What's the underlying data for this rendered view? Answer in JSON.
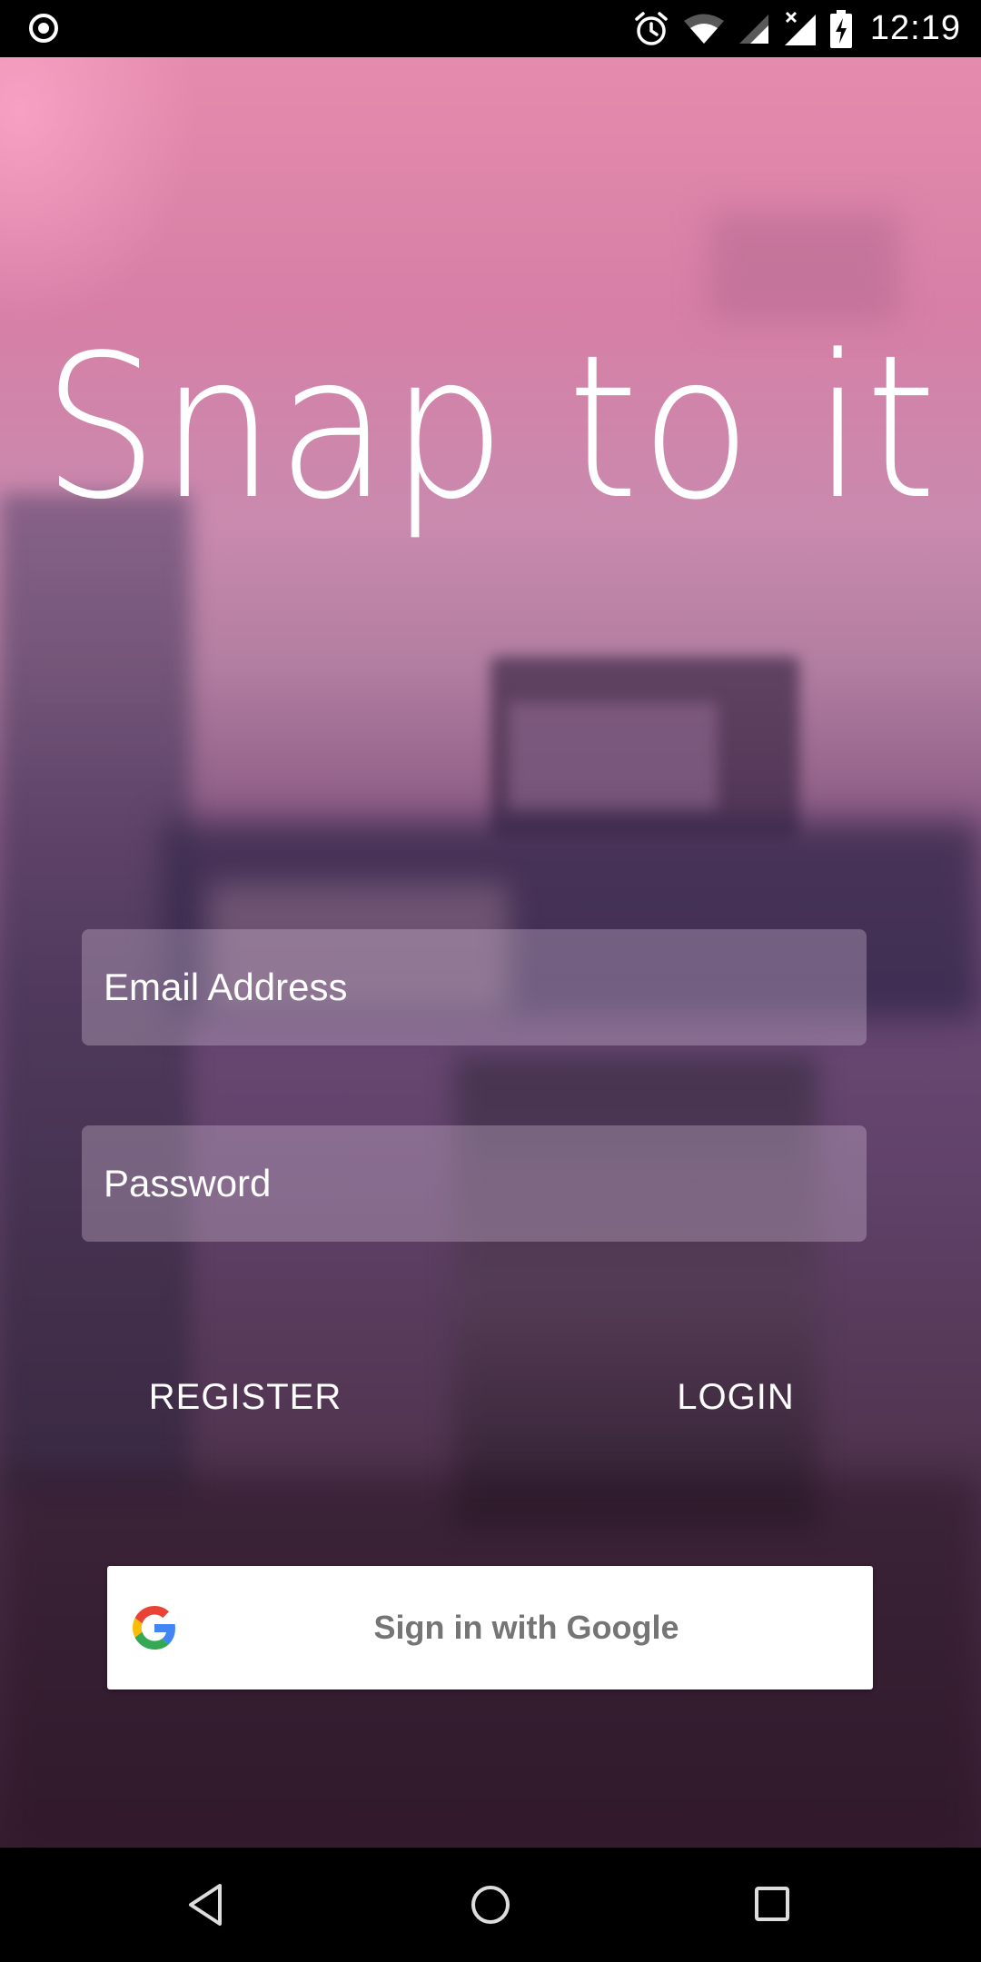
{
  "status_bar": {
    "time": "12:19",
    "icons": [
      "record-icon",
      "alarm-icon",
      "wifi-icon",
      "signal-icon",
      "signal-no-data-icon",
      "battery-charging-icon"
    ]
  },
  "app": {
    "title": "Snap to it"
  },
  "login_form": {
    "email_placeholder": "Email Address",
    "password_placeholder": "Password",
    "register_label": "REGISTER",
    "login_label": "LOGIN"
  },
  "google_signin": {
    "label": "Sign in with Google",
    "icon": "google-logo-icon"
  },
  "nav_bar": {
    "buttons": [
      "back-icon",
      "home-icon",
      "recents-icon"
    ]
  },
  "colors": {
    "background_top": "#e58bad",
    "background_bottom": "#3a1f33",
    "google_text": "#757575",
    "text": "#ffffff"
  }
}
